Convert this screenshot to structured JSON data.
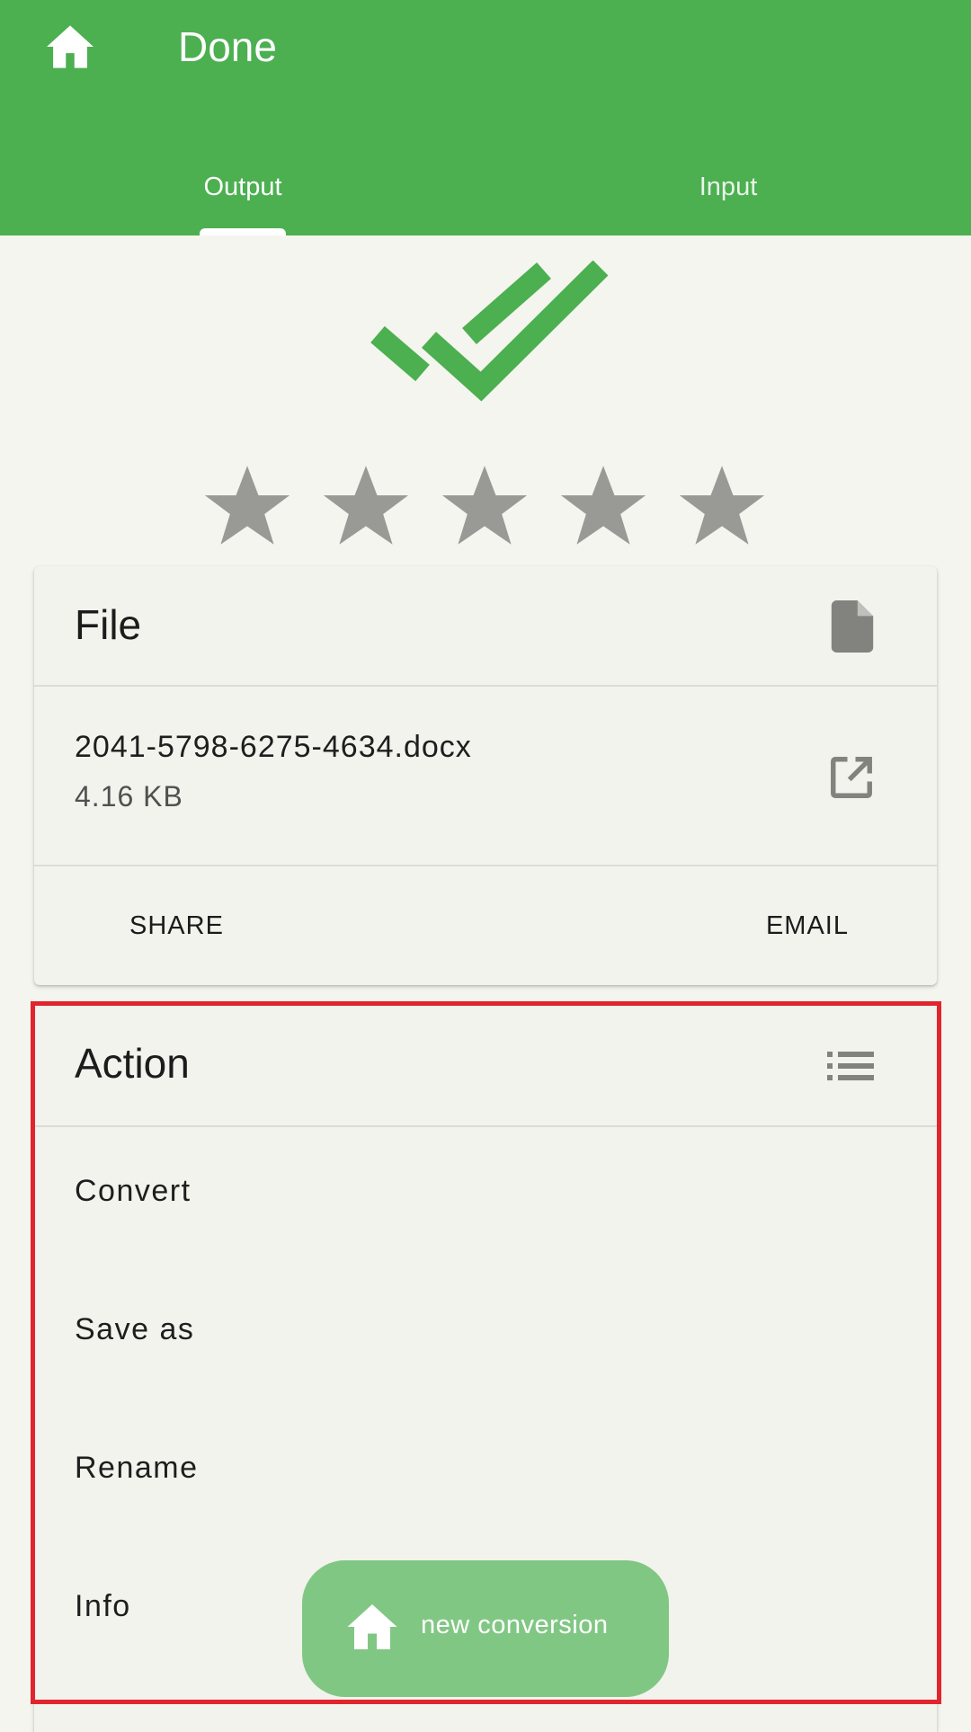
{
  "app_bar": {
    "title": "Done",
    "home_icon": "home-icon",
    "background_color": "#4caf50"
  },
  "tabs": [
    {
      "label": "Output",
      "selected": true
    },
    {
      "label": "Input",
      "selected": false
    }
  ],
  "status": {
    "icon": "done-all-icon",
    "color": "#4caf50"
  },
  "rating": {
    "max": 5,
    "value": 0,
    "star_color": "#999995"
  },
  "file_card": {
    "title": "File",
    "header_icon": "file-icon",
    "file_name": "2041-5798-6275-4634.docx",
    "file_size": "4.16 KB",
    "open_icon": "open-in-new-icon",
    "share_label": "SHARE",
    "email_label": "EMAIL"
  },
  "action_card": {
    "title": "Action",
    "header_icon": "list-icon",
    "items": [
      {
        "label": "Convert"
      },
      {
        "label": "Save as"
      },
      {
        "label": "Rename"
      },
      {
        "label": "Info"
      }
    ]
  },
  "fab": {
    "label": "new conversion",
    "icon": "home-icon",
    "color": "#81c784"
  },
  "highlight_color": "#e0252d"
}
